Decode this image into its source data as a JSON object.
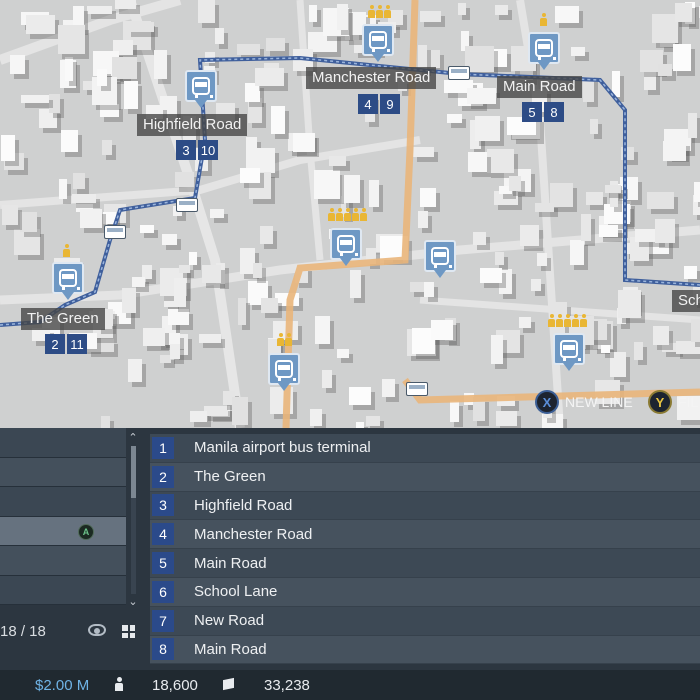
{
  "map": {
    "stops": [
      {
        "name": "Highfield Road",
        "lines": [
          "3",
          "10"
        ]
      },
      {
        "name": "Manchester Road",
        "lines": [
          "4",
          "9"
        ]
      },
      {
        "name": "Main Road",
        "lines": [
          "5",
          "8"
        ]
      },
      {
        "name": "The Green",
        "lines": [
          "2",
          "11"
        ]
      },
      {
        "name": "Sch",
        "lines": []
      }
    ],
    "hints": {
      "x_button": "X",
      "x_label": "NEW LINE",
      "y_button": "Y",
      "y_label": "FIL"
    },
    "colors": {
      "blue_route": "#3f5f9c",
      "orange_route": "#e9b57a",
      "badge": "#2d4c86"
    }
  },
  "panel": {
    "selected_button": "A",
    "count_text": "18 / 18",
    "stop_list": [
      {
        "num": "1",
        "name": "Manila airport bus terminal"
      },
      {
        "num": "2",
        "name": "The Green"
      },
      {
        "num": "3",
        "name": "Highfield Road"
      },
      {
        "num": "4",
        "name": "Manchester Road"
      },
      {
        "num": "5",
        "name": "Main Road"
      },
      {
        "num": "6",
        "name": "School Lane"
      },
      {
        "num": "7",
        "name": "New Road"
      },
      {
        "num": "8",
        "name": "Main Road"
      }
    ],
    "scroll_up": "⌃",
    "scroll_down": "⌄"
  },
  "status": {
    "money": "$2.00 M",
    "population": "18,600",
    "cargo": "33,238"
  }
}
